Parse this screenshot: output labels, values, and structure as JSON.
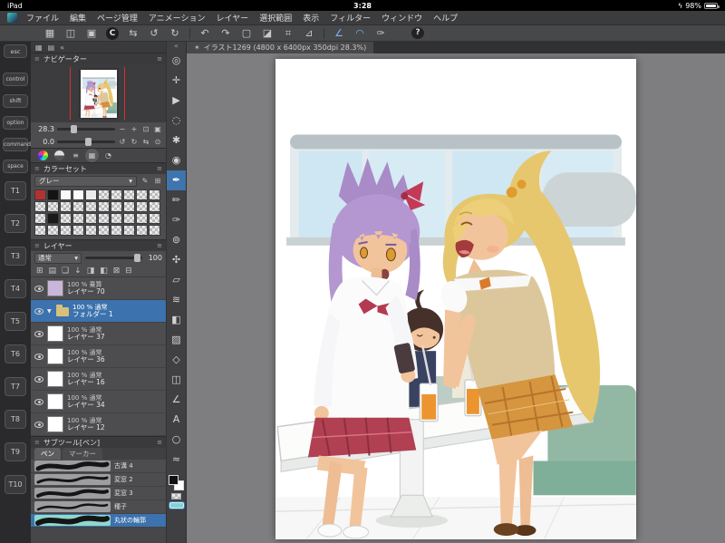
{
  "status_bar": {
    "device": "iPad",
    "time": "3:28",
    "battery": "98%",
    "bolt_glyph": "ϟ"
  },
  "menu_bar": {
    "items": [
      {
        "label": "ファイル"
      },
      {
        "label": "編集"
      },
      {
        "label": "ページ管理"
      },
      {
        "label": "アニメーション"
      },
      {
        "label": "レイヤー"
      },
      {
        "label": "選択範囲"
      },
      {
        "label": "表示"
      },
      {
        "label": "フィルター"
      },
      {
        "label": "ウィンドウ"
      },
      {
        "label": "ヘルプ"
      }
    ]
  },
  "command_bar": {
    "icons": [
      {
        "name": "canvas-grid-icon",
        "glyph": "▦",
        "type": "icon"
      },
      {
        "name": "spread-view-icon",
        "glyph": "◫",
        "type": "icon"
      },
      {
        "name": "page-manager-icon",
        "glyph": "▣",
        "type": "icon"
      },
      {
        "name": "clip-studio-logo-icon",
        "glyph": "C",
        "type": "logo"
      },
      {
        "name": "flip-horizontal-icon",
        "glyph": "⇆",
        "type": "icon"
      },
      {
        "name": "rotate-ccw-icon",
        "glyph": "↺",
        "type": "icon"
      },
      {
        "name": "rotate-cw-icon",
        "glyph": "↻",
        "type": "icon"
      },
      {
        "name": "separator",
        "type": "sep"
      },
      {
        "name": "undo-icon",
        "glyph": "↶",
        "type": "icon"
      },
      {
        "name": "redo-icon",
        "glyph": "↷",
        "type": "icon"
      },
      {
        "name": "deselect-icon",
        "glyph": "▢",
        "type": "icon"
      },
      {
        "name": "invert-selection-icon",
        "glyph": "◪",
        "type": "icon"
      },
      {
        "name": "selection-launcher-icon",
        "glyph": "⌗",
        "type": "icon"
      },
      {
        "name": "transform-icon",
        "glyph": "⊿",
        "type": "icon"
      },
      {
        "name": "separator",
        "type": "sep"
      },
      {
        "name": "snap-to-ruler-icon",
        "glyph": "∠",
        "type": "icon",
        "active": true
      },
      {
        "name": "snap-to-special-ruler-icon",
        "glyph": "◠",
        "type": "icon",
        "active": true
      },
      {
        "name": "pen-pressure-icon",
        "glyph": "✑",
        "type": "icon"
      },
      {
        "name": "help-icon",
        "glyph": "?",
        "type": "help"
      }
    ]
  },
  "edge_keys": {
    "keys": [
      {
        "label": "esc",
        "cls": "esc"
      },
      {
        "label": "control",
        "cls": "mod"
      },
      {
        "label": "shift",
        "cls": "mod"
      },
      {
        "label": "option",
        "cls": "mod"
      },
      {
        "label": "command",
        "cls": "mod"
      },
      {
        "label": "space",
        "cls": "mod"
      },
      {
        "label": "T1",
        "cls": "tkey"
      },
      {
        "label": "T2",
        "cls": "tkey"
      },
      {
        "label": "T3",
        "cls": "tkey"
      },
      {
        "label": "T4",
        "cls": "tkey"
      },
      {
        "label": "T5",
        "cls": "tkey"
      },
      {
        "label": "T6",
        "cls": "tkey"
      },
      {
        "label": "T7",
        "cls": "tkey"
      },
      {
        "label": "T8",
        "cls": "tkey"
      },
      {
        "label": "T9",
        "cls": "tkey"
      },
      {
        "label": "T10",
        "cls": "tkey"
      }
    ]
  },
  "panels": {
    "palette_menu_glyph": "≡",
    "dock_icons": [
      {
        "name": "workspace-grid-icon",
        "glyph": "▦"
      },
      {
        "name": "palette-list-icon",
        "glyph": "▤"
      },
      {
        "name": "collapse-panels-icon",
        "glyph": "«"
      }
    ],
    "navigator": {
      "title": "ナビゲーター",
      "zoom": "28.3",
      "rotation": "0.0",
      "zoom_icons": [
        {
          "name": "zoom-out-icon",
          "glyph": "−"
        },
        {
          "name": "zoom-in-icon",
          "glyph": "+"
        },
        {
          "name": "fit-to-screen-icon",
          "glyph": "⊡"
        },
        {
          "name": "zoom-100-icon",
          "glyph": "▣"
        }
      ],
      "rotate_icons": [
        {
          "name": "rotate-ccw-icon",
          "glyph": "↺"
        },
        {
          "name": "rotate-cw-icon",
          "glyph": "↻"
        },
        {
          "name": "flip-horizontal-icon",
          "glyph": "⇆"
        },
        {
          "name": "reset-view-icon",
          "glyph": "⊙"
        }
      ]
    },
    "color_bar": {
      "icons": [
        {
          "name": "color-wheel-icon",
          "type": "wheel"
        },
        {
          "name": "color-circle-icon",
          "type": "circle"
        },
        {
          "name": "color-slider-icon",
          "glyph": "≡"
        },
        {
          "name": "color-set-icon",
          "glyph": "▦",
          "active": true
        },
        {
          "name": "color-history-icon",
          "glyph": "◔"
        }
      ]
    },
    "color_set": {
      "title": "カラーセット",
      "set_name": "グレー",
      "caret": "▾",
      "edit_icons": [
        {
          "name": "edit-color-set-icon",
          "glyph": "✎"
        },
        {
          "name": "add-swatch-icon",
          "glyph": "⊞"
        }
      ],
      "swatches": [
        "#b23232",
        "#141414",
        "#fafafa",
        "#fafafa",
        "#ececec",
        "T",
        "T",
        "T",
        "T",
        "T",
        "T",
        "T",
        "T",
        "T",
        "T",
        "T",
        "T",
        "T",
        "T",
        "T",
        "T",
        "#1a1a1a",
        "T",
        "T",
        "T",
        "T",
        "T",
        "T",
        "T",
        "T",
        "T",
        "T",
        "T",
        "T",
        "T",
        "T",
        "T",
        "T",
        "T",
        "T"
      ]
    },
    "layers": {
      "title": "レイヤー",
      "blend_mode": "通常",
      "caret": "▾",
      "opacity": "100",
      "toolbar_icons": [
        {
          "name": "new-layer-icon",
          "glyph": "⊞"
        },
        {
          "name": "new-folder-icon",
          "glyph": "▤"
        },
        {
          "name": "duplicate-layer-icon",
          "glyph": "❏"
        },
        {
          "name": "merge-down-icon",
          "glyph": "↓"
        },
        {
          "name": "layer-mask-icon",
          "glyph": "◨"
        },
        {
          "name": "clipping-icon",
          "glyph": "◧"
        },
        {
          "name": "lock-layer-icon",
          "glyph": "⊠"
        },
        {
          "name": "delete-layer-icon",
          "glyph": "⊟"
        }
      ],
      "items": [
        {
          "meta": "100 % 乗算",
          "name": "レイヤー 70",
          "thumb": "#c9b6da"
        },
        {
          "meta": "100 % 通常",
          "name": "フォルダー 1",
          "folder": true,
          "selected": true
        },
        {
          "meta": "100 % 通常",
          "name": "レイヤー 37",
          "thumb": "T"
        },
        {
          "meta": "100 % 通常",
          "name": "レイヤー 36",
          "thumb": "T"
        },
        {
          "meta": "100 % 通常",
          "name": "レイヤー 16",
          "thumb": "T"
        },
        {
          "meta": "100 % 通常",
          "name": "レイヤー 34",
          "thumb": "T"
        },
        {
          "meta": "100 % 通常",
          "name": "レイヤー 12",
          "thumb": "T"
        }
      ]
    },
    "subtool": {
      "title": "サブツール[ペン]",
      "tabs": [
        {
          "label": "ペン",
          "active": true
        },
        {
          "label": "マーカー"
        }
      ],
      "brushes": [
        {
          "name": "古溝 4",
          "stroke": 5
        },
        {
          "name": "変窓 2",
          "stroke": 3
        },
        {
          "name": "変窓 3",
          "stroke": 4
        },
        {
          "name": "種子",
          "stroke": 2.5
        },
        {
          "name": "丸状の輪郭",
          "stroke": 6,
          "selected": true
        }
      ]
    }
  },
  "tool_strip": {
    "collapse_glyph": "«",
    "tools": [
      {
        "name": "zoom-tool",
        "glyph": "◎"
      },
      {
        "name": "move-tool",
        "glyph": "✛"
      },
      {
        "name": "operation-tool",
        "glyph": "▶"
      },
      {
        "name": "selection-tool",
        "glyph": "◌"
      },
      {
        "name": "auto-select-tool",
        "glyph": "✱"
      },
      {
        "name": "eyedropper-tool",
        "glyph": "◉"
      },
      {
        "name": "pen-tool",
        "glyph": "✒",
        "active": true
      },
      {
        "name": "pencil-tool",
        "glyph": "✏"
      },
      {
        "name": "brush-tool",
        "glyph": "✑"
      },
      {
        "name": "airbrush-tool",
        "glyph": "⊚"
      },
      {
        "name": "decoration-tool",
        "glyph": "✣"
      },
      {
        "name": "eraser-tool",
        "glyph": "▱"
      },
      {
        "name": "blend-tool",
        "glyph": "≋"
      },
      {
        "name": "fill-tool",
        "glyph": "◧"
      },
      {
        "name": "gradient-tool",
        "glyph": "▨"
      },
      {
        "name": "figure-tool",
        "glyph": "◇"
      },
      {
        "name": "frame-border-tool",
        "glyph": "◫"
      },
      {
        "name": "ruler-tool",
        "glyph": "∠"
      },
      {
        "name": "text-tool",
        "glyph": "A"
      },
      {
        "name": "balloon-tool",
        "glyph": "○"
      },
      {
        "name": "line-correction-tool",
        "glyph": "≈"
      }
    ],
    "main_color": "#111111",
    "sub_color": "#ffffff",
    "accent_chip": "#7cd8cf"
  },
  "document": {
    "tab_title": "イラスト1269 (4800 x 6400px 350dpi 28.3%)",
    "star_glyph": "✶"
  }
}
